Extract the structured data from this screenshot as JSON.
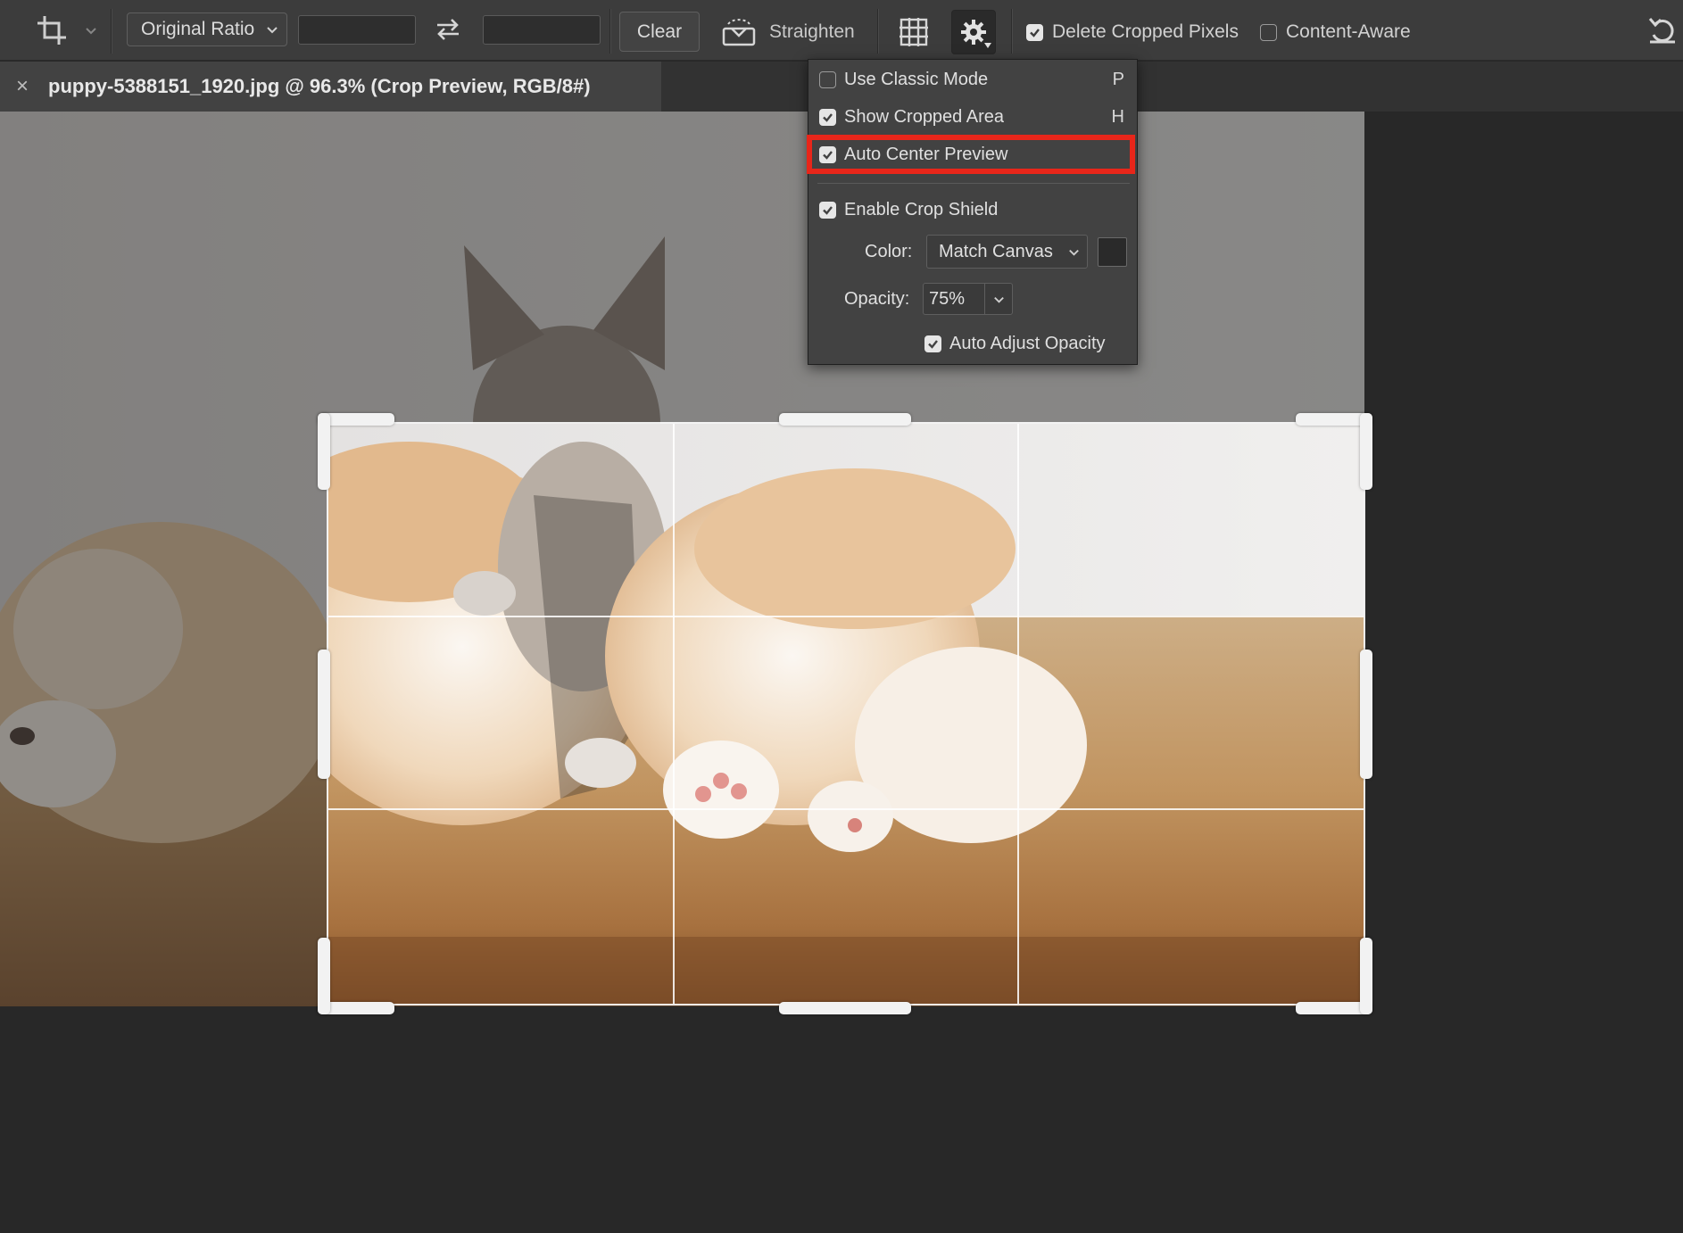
{
  "options_bar": {
    "crop_tool_icon": "crop-icon",
    "ratio_select": {
      "value": "Original Ratio"
    },
    "width_field": {
      "value": ""
    },
    "swap_icon": "swap-arrows-icon",
    "height_field": {
      "value": ""
    },
    "clear_label": "Clear",
    "straighten_icon": "level-icon",
    "straighten_label": "Straighten",
    "overlay_icon": "grid-overlay-icon",
    "settings_icon": "gear-icon",
    "delete_cropped_pixels": {
      "label": "Delete Cropped Pixels",
      "checked": true
    },
    "content_aware": {
      "label": "Content-Aware",
      "checked": false
    },
    "reset_icon": "reset-icon"
  },
  "document_tab": {
    "close_symbol": "×",
    "title": "puppy-5388151_1920.jpg @ 96.3% (Crop Preview, RGB/8#)"
  },
  "crop_settings_popup": {
    "use_classic_mode": {
      "label": "Use Classic Mode",
      "shortcut": "P",
      "checked": false
    },
    "show_cropped_area": {
      "label": "Show Cropped Area",
      "shortcut": "H",
      "checked": true
    },
    "auto_center_preview": {
      "label": "Auto Center Preview",
      "checked": true,
      "highlighted": true
    },
    "enable_crop_shield": {
      "label": "Enable Crop Shield",
      "checked": true
    },
    "color": {
      "label": "Color:",
      "value": "Match Canvas"
    },
    "opacity": {
      "label": "Opacity:",
      "value": "75%"
    },
    "auto_adjust_opacity": {
      "label": "Auto Adjust Opacity",
      "checked": true
    }
  },
  "colors": {
    "highlight": "#e8261a",
    "options_bar_bg": "#3c3c3c",
    "canvas_bg": "#282828",
    "popup_bg": "#424242"
  }
}
